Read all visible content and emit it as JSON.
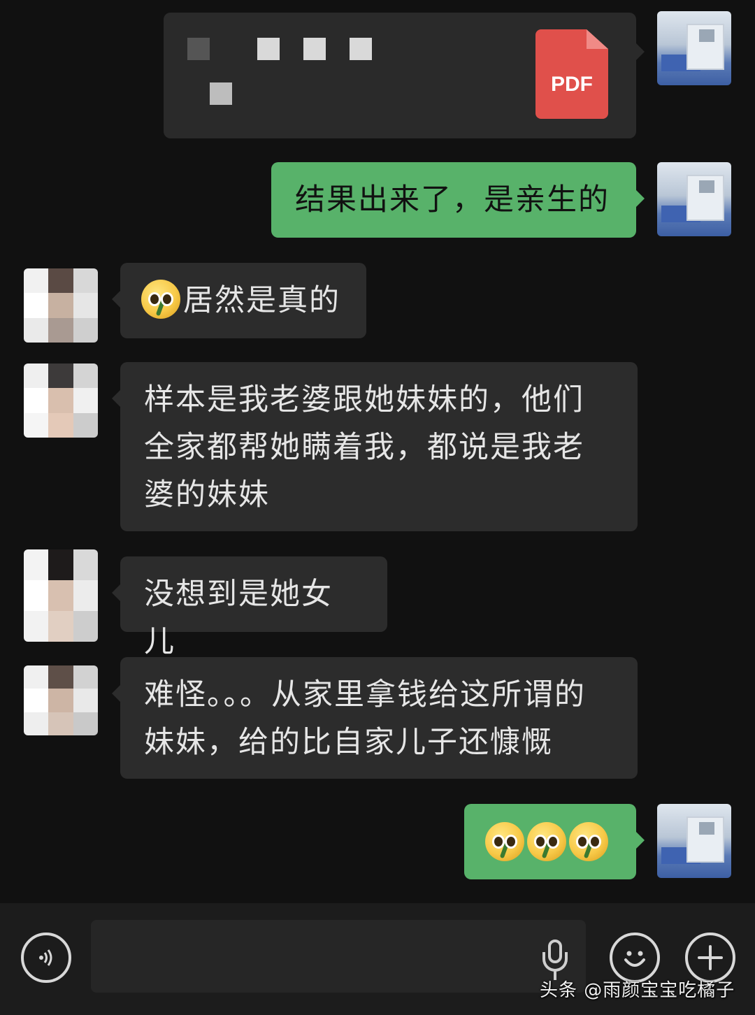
{
  "messages": [
    {
      "from": "self",
      "type": "file",
      "file_icon_label": "PDF"
    },
    {
      "from": "self",
      "type": "text",
      "text": "结果出来了，是亲生的"
    },
    {
      "from": "other",
      "type": "text",
      "emoji": "broken-smile-emoji",
      "text": "居然是真的"
    },
    {
      "from": "other",
      "type": "text",
      "text": "样本是我老婆跟她妹妹的，他们全家都帮她瞒着我，都说是我老婆的妹妹"
    },
    {
      "from": "other",
      "type": "text",
      "text": "没想到是她女儿"
    },
    {
      "from": "other",
      "type": "text",
      "text": "难怪。。。从家里拿钱给这所谓的妹妹，给的比自家儿子还慷慨"
    },
    {
      "from": "self",
      "type": "emoji",
      "emoji": "broken-smile-emoji",
      "count": 3
    }
  ],
  "toolbar": {
    "voice_icon": "voice-icon",
    "mic_icon": "mic-icon",
    "emoji_icon": "smile-icon",
    "plus_icon": "plus-icon"
  },
  "watermark": "头条 @雨颜宝宝吃橘子",
  "colors": {
    "self_bubble": "#58b26a",
    "other_bubble": "#2c2c2c",
    "pdf_red": "#e0504b",
    "background": "#111111"
  }
}
